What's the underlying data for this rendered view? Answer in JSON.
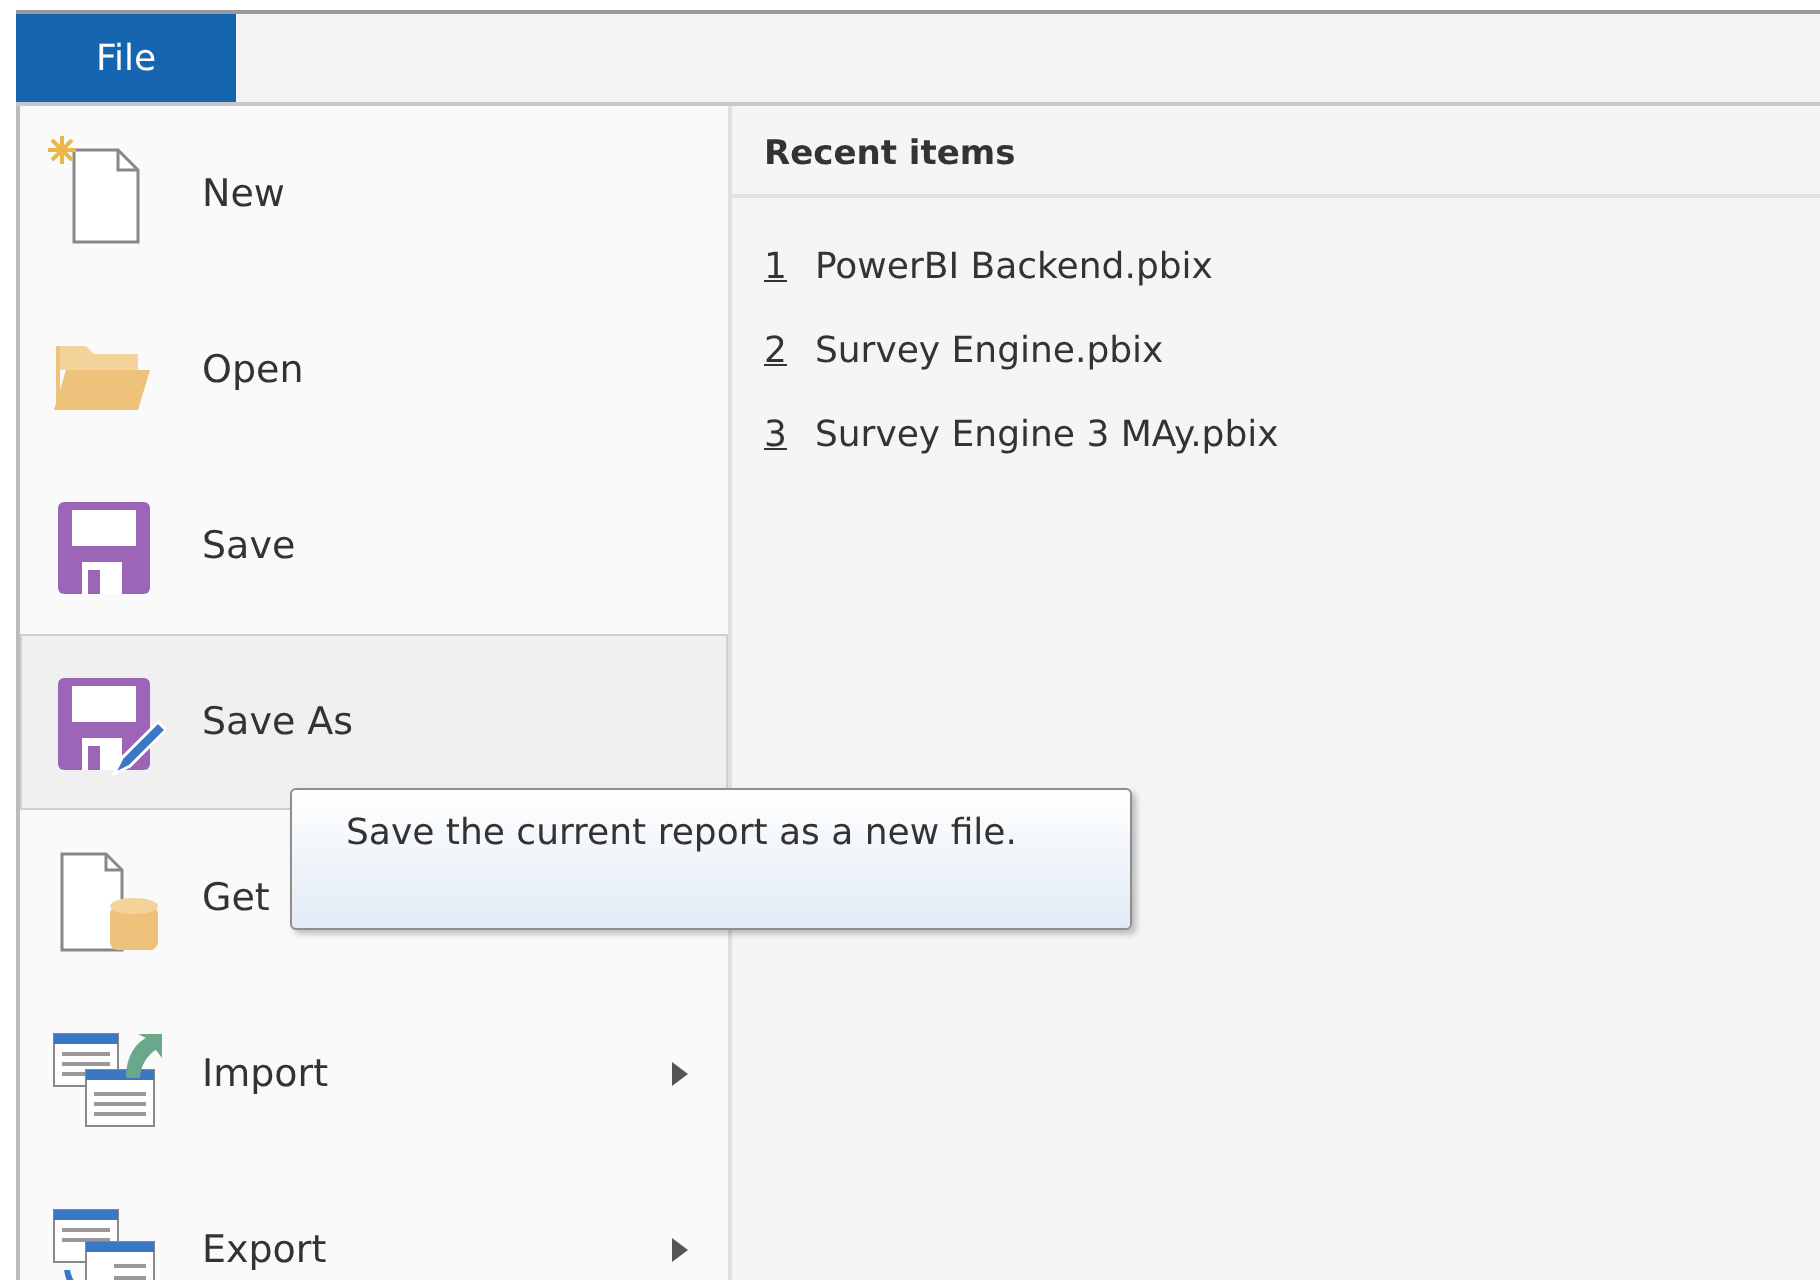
{
  "menu_tab": {
    "label": "File",
    "selected": true
  },
  "menu_items": [
    {
      "label": "New",
      "kind": "new",
      "hovered": false,
      "submenu": false
    },
    {
      "label": "Open",
      "kind": "open",
      "hovered": false,
      "submenu": false
    },
    {
      "label": "Save",
      "kind": "save",
      "hovered": false,
      "submenu": false
    },
    {
      "label": "Save As",
      "kind": "saveas",
      "hovered": true,
      "submenu": false
    },
    {
      "label": "Get",
      "kind": "getdata",
      "hovered": false,
      "submenu": false
    },
    {
      "label": "Import",
      "kind": "import",
      "hovered": false,
      "submenu": true
    },
    {
      "label": "Export",
      "kind": "export",
      "hovered": false,
      "submenu": true
    }
  ],
  "recent": {
    "title": "Recent items",
    "items": [
      {
        "number": "1",
        "name": "PowerBI Backend.pbix"
      },
      {
        "number": "2",
        "name": "Survey Engine.pbix"
      },
      {
        "number": "3",
        "name": "Survey Engine 3 MAy.pbix"
      }
    ]
  },
  "tooltip": {
    "text": "Save the current report as a new file."
  }
}
